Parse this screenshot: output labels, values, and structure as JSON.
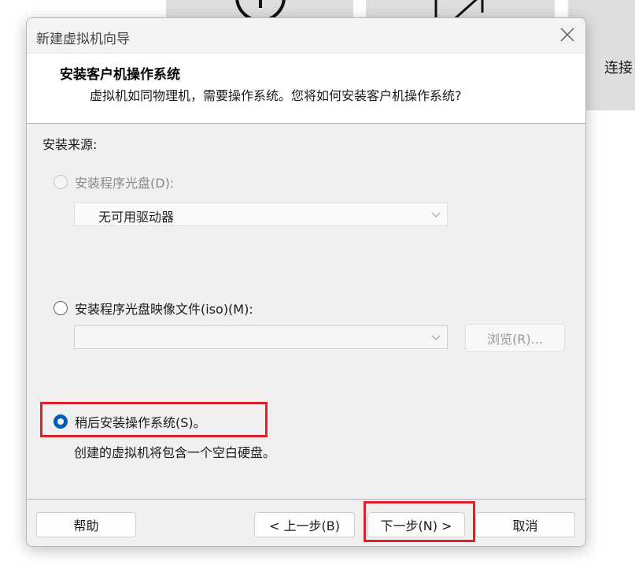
{
  "background": {
    "side_text": "连接"
  },
  "dialog": {
    "title": "新建虚拟机向导",
    "header_title": "安装客户机操作系统",
    "header_desc": "虚拟机如同物理机，需要操作系统。您将如何安装客户机操作系统?",
    "source_label": "安装来源:",
    "options": {
      "disc": {
        "label": "安装程序光盘(D):",
        "dropdown_value": "无可用驱动器",
        "enabled": false
      },
      "iso": {
        "label": "安装程序光盘映像文件(iso)(M):",
        "input_value": "",
        "browse_label": "浏览(R)..."
      },
      "later": {
        "label": "稍后安装操作系统(S)。",
        "description": "创建的虚拟机将包含一个空白硬盘。",
        "selected": true
      }
    },
    "buttons": {
      "help": "帮助",
      "back": "< 上一步(B)",
      "next": "下一步(N) >",
      "cancel": "取消"
    }
  },
  "colors": {
    "accent": "#005fb8",
    "highlight": "#e0202a"
  },
  "icons": [
    "plus-circle-icon",
    "edit-icon",
    "close-icon",
    "chevron-down-icon"
  ]
}
